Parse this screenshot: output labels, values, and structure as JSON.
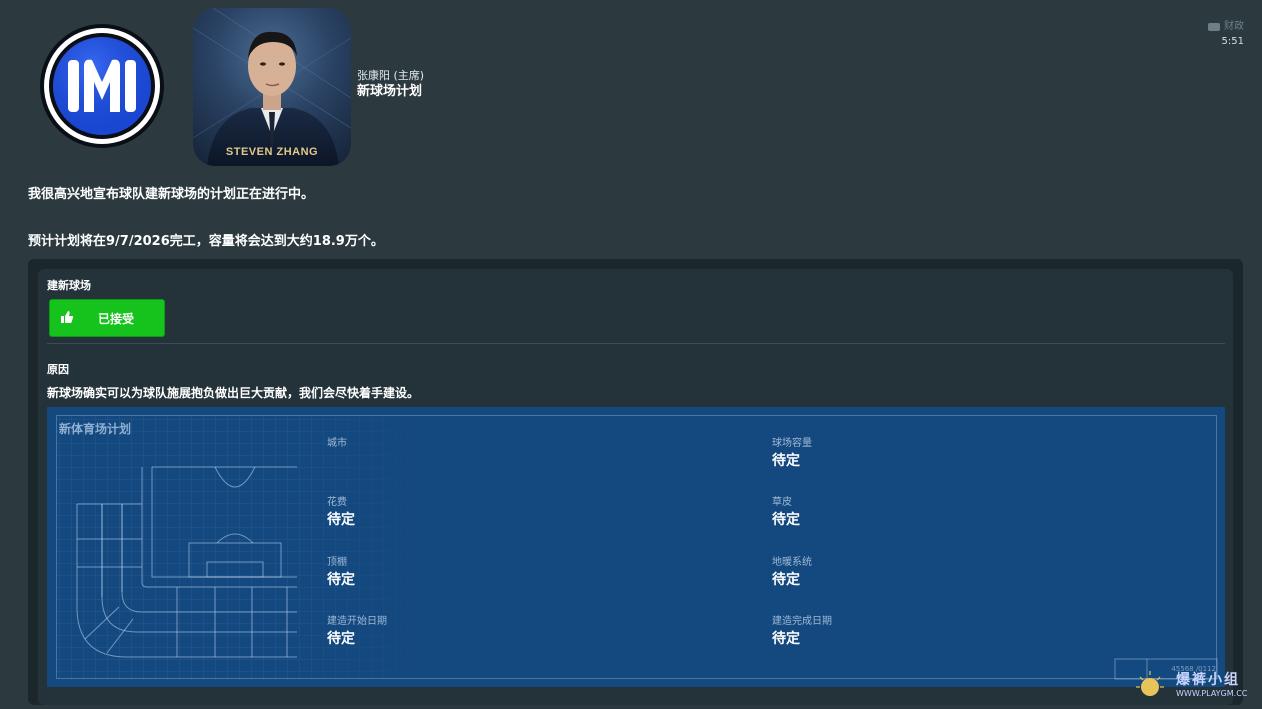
{
  "header": {
    "sender_name": "张康阳 (主席)",
    "subject": "新球场计划",
    "tag": "财政",
    "time": "5:51",
    "photo_caption": "STEVEN ZHANG"
  },
  "message": {
    "line1": "我很高兴地宣布球队建新球场的计划正在进行中。",
    "line2": "预计计划将在9/7/2026完工，容量将会达到大约18.9万个。"
  },
  "panel": {
    "section_title": "建新球场",
    "accepted_label": "已接受",
    "reason_title": "原因",
    "reason_text": "新球场确实可以为球队施展抱负做出巨大贡献，我们会尽快着手建设。"
  },
  "blueprint": {
    "title": "新体育场计划",
    "code": "45568 /0112",
    "fields": {
      "city": {
        "label": "城市",
        "value": ""
      },
      "capacity": {
        "label": "球场容量",
        "value": "待定"
      },
      "cost": {
        "label": "花费",
        "value": "待定"
      },
      "pitch": {
        "label": "草皮",
        "value": "待定"
      },
      "roof": {
        "label": "顶棚",
        "value": "待定"
      },
      "undersoil_heating": {
        "label": "地暖系统",
        "value": "待定"
      },
      "build_start": {
        "label": "建造开始日期",
        "value": "待定"
      },
      "build_end": {
        "label": "建造完成日期",
        "value": "待定"
      }
    }
  },
  "watermark": {
    "text": "爆裤小组",
    "url": "WWW.PLAYGM.CC"
  },
  "colors": {
    "background": "#2c3a40",
    "accept_green": "#16c31c",
    "blueprint_blue": "#14497f",
    "inter_blue": "#0b3fd1"
  }
}
